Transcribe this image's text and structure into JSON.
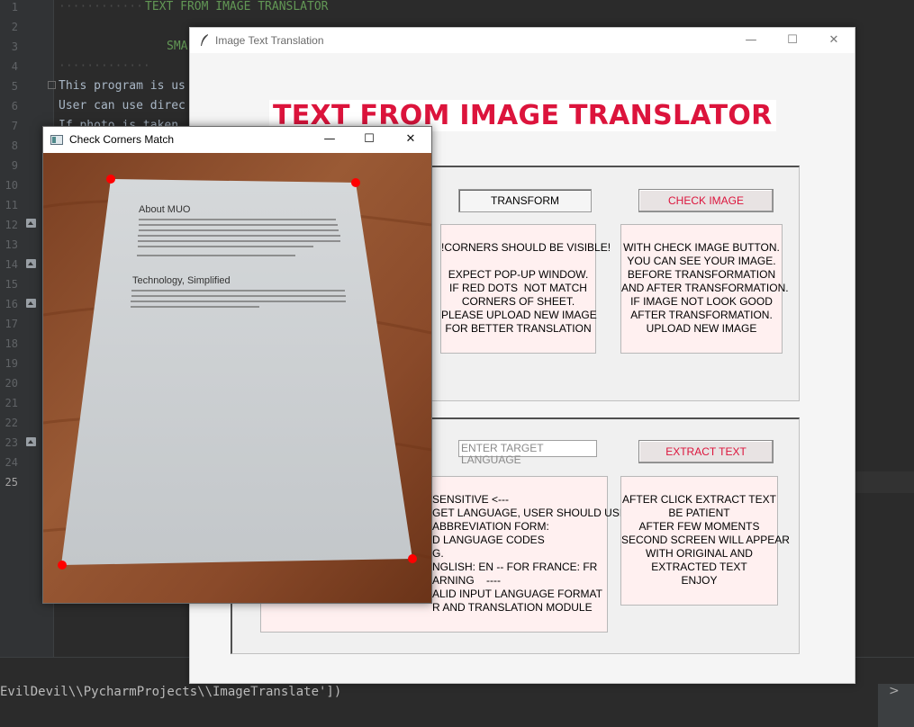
{
  "ide": {
    "line_numbers": [
      "1",
      "2",
      "3",
      "4",
      "5",
      "6",
      "7",
      "8",
      "9",
      "10",
      "11",
      "12",
      "13",
      "14",
      "15",
      "16",
      "17",
      "18",
      "19",
      "20",
      "21",
      "22",
      "23",
      "24",
      "25"
    ],
    "code_lines": {
      "line1": "TEXT FROM IMAGE TRANSLATOR",
      "line3": "SMA",
      "line5": "This program is us",
      "line6": "User can use direc",
      "line7": "If photo is taken",
      "line8": "-"
    },
    "console_text": "EvilDevil\\\\PycharmProjects\\\\ImageTranslate'])",
    "console_arrow": ">"
  },
  "main_window": {
    "title": "Image Text Translation",
    "icon": "feather-icon",
    "controls": {
      "minimize": "—",
      "maximize": "☐",
      "close": "✕"
    },
    "heading": "TEXT FROM IMAGE TRANSLATOR",
    "heading_color": "#dc143c",
    "top_section": {
      "transform_button": "TRANSFORM",
      "check_image_button": "CHECK IMAGE",
      "corners_info": [
        "!CORNERS SHOULD BE VISIBLE!",
        "",
        "EXPECT POP-UP WINDOW.",
        "IF RED DOTS  NOT MATCH",
        "CORNERS OF SHEET.",
        "PLEASE UPLOAD NEW IMAGE",
        "FOR BETTER TRANSLATION"
      ],
      "check_info": [
        "WITH CHECK IMAGE BUTTON.",
        "YOU CAN SEE YOUR IMAGE.",
        "BEFORE TRANSFORMATION",
        "AND AFTER TRANSFORMATION.",
        "IF IMAGE NOT LOOK GOOD",
        "AFTER TRANSFORMATION.",
        "UPLOAD NEW IMAGE"
      ]
    },
    "bottom_section": {
      "target_language_placeholder": "ENTER TARGET LANGUAGE",
      "extract_button": "EXTRACT TEXT",
      "language_info": [
        "SENSITIVE <---",
        "GET LANGUAGE, USER SHOULD USE",
        "ABBREVIATION FORM:",
        "D LANGUAGE CODES",
        "G.",
        "NGLISH: EN -- FOR FRANCE: FR",
        "ARNING    ----",
        "ALID INPUT LANGUAGE FORMAT",
        "R AND TRANSLATION MODULE"
      ],
      "extract_info": [
        "AFTER CLICK EXTRACT TEXT",
        "BE PATIENT",
        "AFTER FEW MOMENTS",
        "SECOND SCREEN WILL APPEAR",
        "WITH ORIGINAL AND",
        "EXTRACTED TEXT",
        "ENJOY"
      ]
    }
  },
  "corners_window": {
    "title": "Check Corners Match",
    "icon": "image-window-icon",
    "controls": {
      "minimize": "—",
      "maximize": "☐",
      "close": "✕"
    },
    "photo": {
      "doc_heading_1": "About MUO",
      "doc_heading_2": "Technology, Simplified",
      "dot_color": "#ff0000",
      "table_color": "#8a4a2a",
      "paper_color": "#c9cdd0"
    }
  }
}
